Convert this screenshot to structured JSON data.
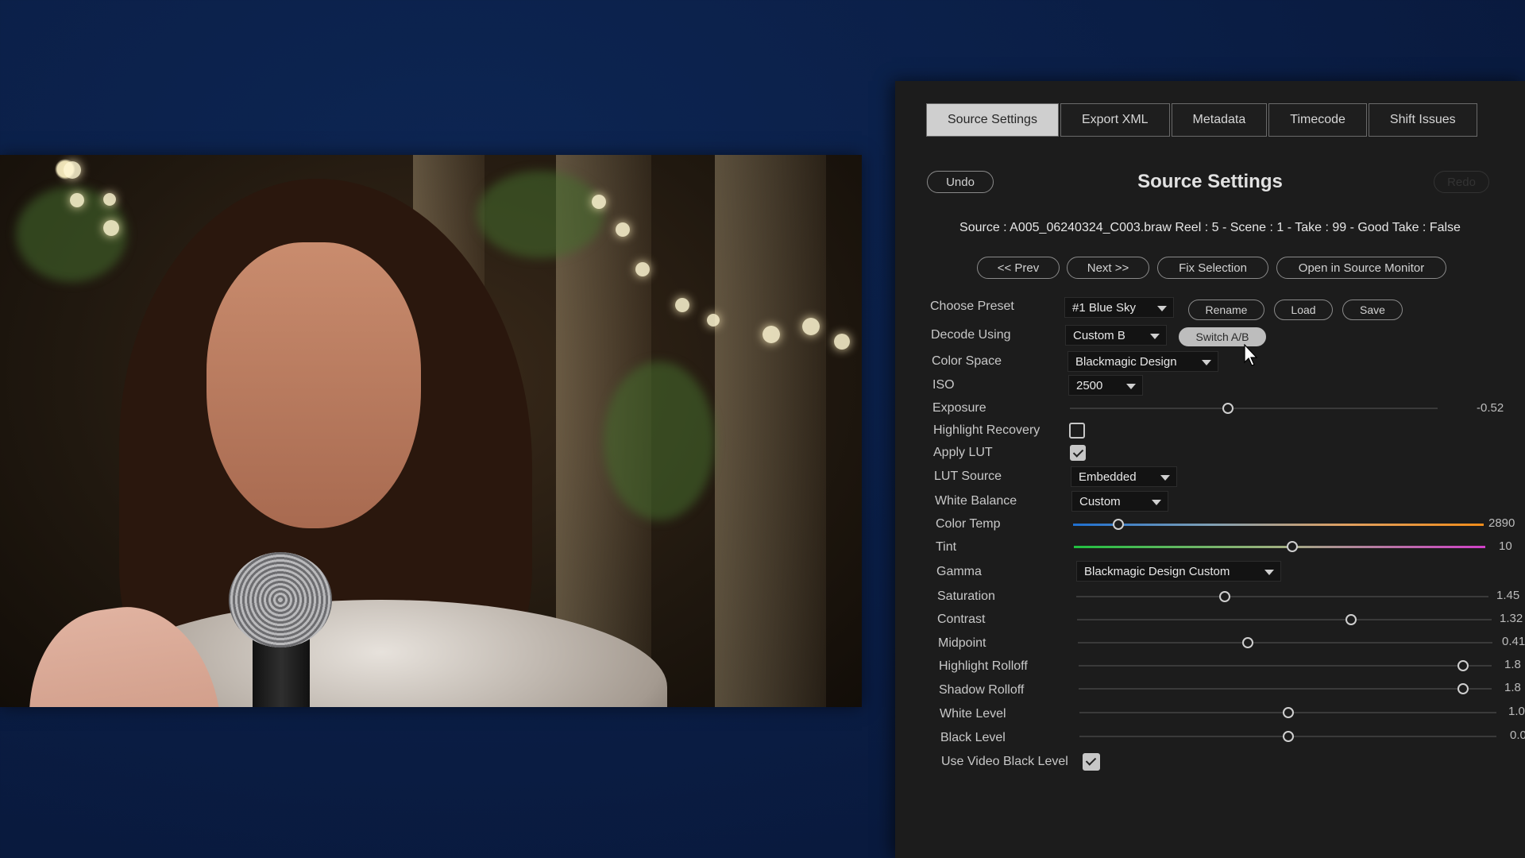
{
  "tabs": [
    "Source Settings",
    "Export XML",
    "Metadata",
    "Timecode",
    "Shift Issues"
  ],
  "undo_label": "Undo",
  "redo_label": "Redo",
  "title": "Source Settings",
  "source_line": "Source : A005_06240324_C003.braw   Reel : 5 - Scene : 1 - Take : 99 - Good Take : False",
  "nav": {
    "prev": "<< Prev",
    "next": "Next >>",
    "fix": "Fix Selection",
    "open": "Open in Source Monitor"
  },
  "preset": {
    "label": "Choose Preset",
    "value": "#1 Blue Sky",
    "rename": "Rename",
    "load": "Load",
    "save": "Save"
  },
  "decode": {
    "label": "Decode Using",
    "value": "Custom B",
    "switch": "Switch A/B"
  },
  "color_space": {
    "label": "Color Space",
    "value": "Blackmagic Design"
  },
  "iso": {
    "label": "ISO",
    "value": "2500"
  },
  "exposure": {
    "label": "Exposure",
    "value": "-0.52",
    "fraction": 0.43
  },
  "highlight_recovery": {
    "label": "Highlight Recovery",
    "checked": false
  },
  "apply_lut": {
    "label": "Apply LUT",
    "checked": true
  },
  "lut_source": {
    "label": "LUT Source",
    "value": "Embedded"
  },
  "white_balance": {
    "label": "White Balance",
    "value": "Custom"
  },
  "color_temp": {
    "label": "Color Temp",
    "value": "2890",
    "fraction": 0.11
  },
  "tint": {
    "label": "Tint",
    "value": "10",
    "fraction": 0.53
  },
  "gamma": {
    "label": "Gamma",
    "value": "Blackmagic Design Custom"
  },
  "saturation": {
    "label": "Saturation",
    "value": "1.45",
    "fraction": 0.36
  },
  "contrast": {
    "label": "Contrast",
    "value": "1.32",
    "fraction": 0.66
  },
  "midpoint": {
    "label": "Midpoint",
    "value": "0.41",
    "fraction": 0.41
  },
  "highlight_rolloff": {
    "label": "Highlight Rolloff",
    "value": "1.8",
    "fraction": 0.93
  },
  "shadow_rolloff": {
    "label": "Shadow Rolloff",
    "value": "1.8",
    "fraction": 0.93
  },
  "white_level": {
    "label": "White Level",
    "value": "1.0",
    "fraction": 0.5
  },
  "black_level": {
    "label": "Black Level",
    "value": "0.0",
    "fraction": 0.5
  },
  "use_video_black": {
    "label": "Use Video Black Level",
    "checked": true
  }
}
